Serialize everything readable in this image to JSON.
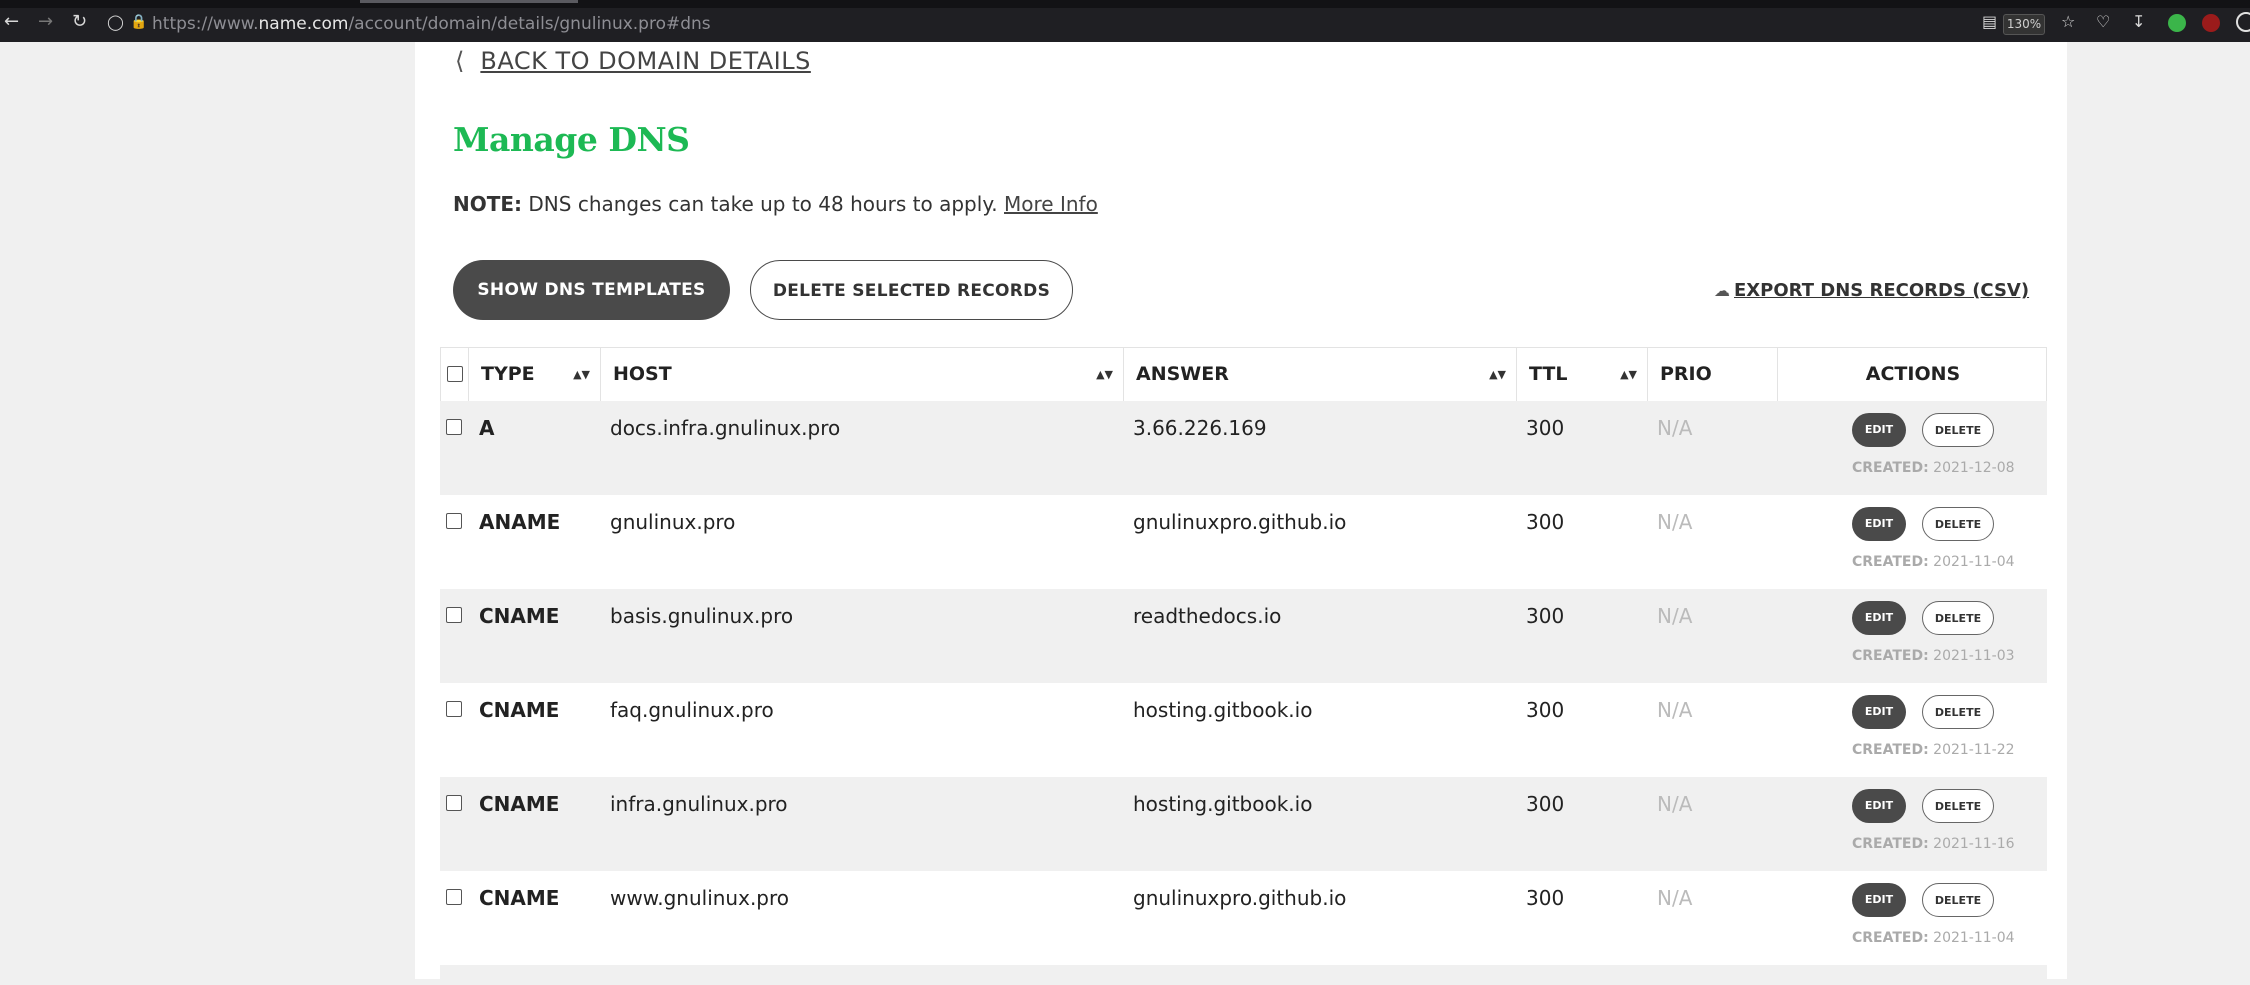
{
  "browser": {
    "url_prefix": "https://www.",
    "url_domain": "name.com",
    "url_path": "/account/domain/details/gnulinux.pro#dns",
    "zoom": "130%"
  },
  "page": {
    "back_label": "BACK TO DOMAIN DETAILS",
    "title": "Manage DNS",
    "note_label": "NOTE:",
    "note_text": "DNS changes can take up to 48 hours to apply.",
    "note_link": "More Info",
    "show_templates": "SHOW DNS TEMPLATES",
    "delete_selected": "DELETE SELECTED RECORDS",
    "export": "EXPORT DNS RECORDS (CSV)"
  },
  "table": {
    "headers": {
      "type": "TYPE",
      "host": "HOST",
      "answer": "ANSWER",
      "ttl": "TTL",
      "prio": "PRIO",
      "actions": "ACTIONS"
    },
    "edit_label": "EDIT",
    "delete_label": "DELETE",
    "created_label": "CREATED:",
    "rows": [
      {
        "type": "A",
        "host": "docs.infra.gnulinux.pro",
        "answer": "3.66.226.169",
        "ttl": "300",
        "prio": "N/A",
        "created": "2021-12-08"
      },
      {
        "type": "ANAME",
        "host": "gnulinux.pro",
        "answer": "gnulinuxpro.github.io",
        "ttl": "300",
        "prio": "N/A",
        "created": "2021-11-04"
      },
      {
        "type": "CNAME",
        "host": "basis.gnulinux.pro",
        "answer": "readthedocs.io",
        "ttl": "300",
        "prio": "N/A",
        "created": "2021-11-03"
      },
      {
        "type": "CNAME",
        "host": "faq.gnulinux.pro",
        "answer": "hosting.gitbook.io",
        "ttl": "300",
        "prio": "N/A",
        "created": "2021-11-22"
      },
      {
        "type": "CNAME",
        "host": "infra.gnulinux.pro",
        "answer": "hosting.gitbook.io",
        "ttl": "300",
        "prio": "N/A",
        "created": "2021-11-16"
      },
      {
        "type": "CNAME",
        "host": "www.gnulinux.pro",
        "answer": "gnulinuxpro.github.io",
        "ttl": "300",
        "prio": "N/A",
        "created": "2021-11-04"
      }
    ]
  }
}
